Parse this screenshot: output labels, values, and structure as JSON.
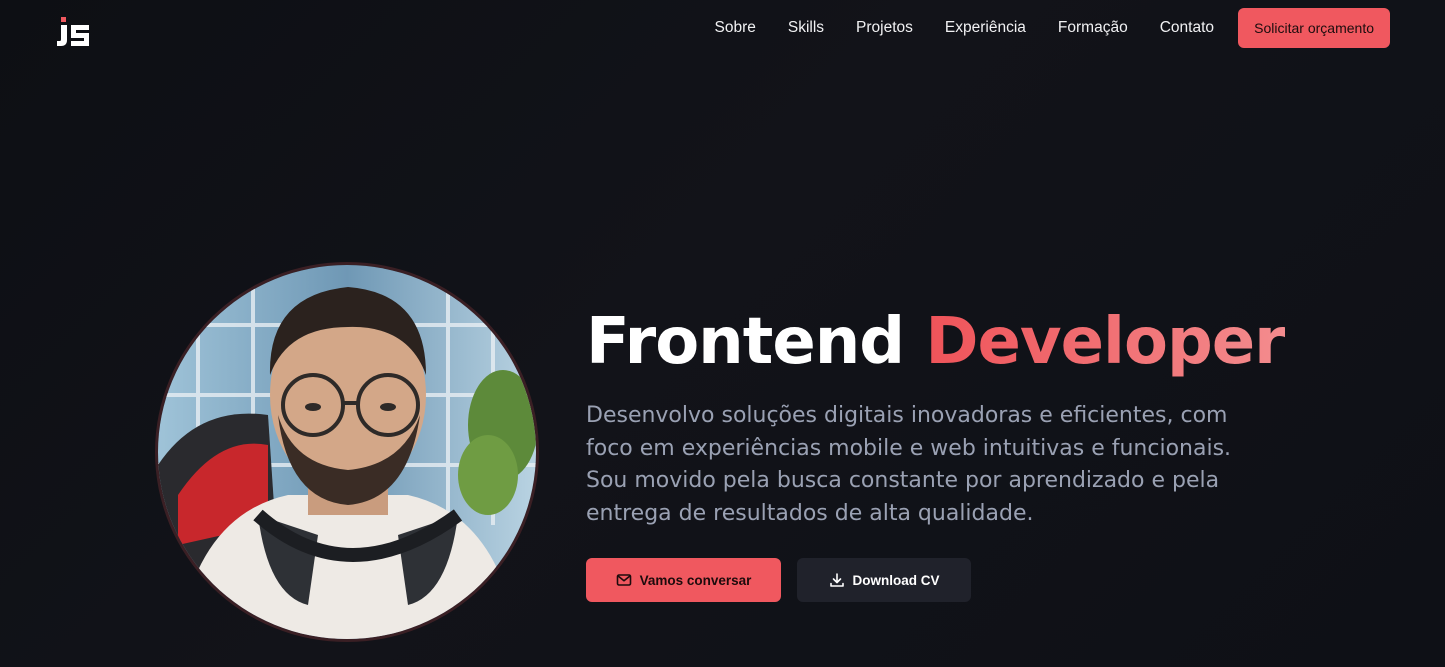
{
  "header": {
    "logo_text": "JS",
    "nav": [
      "Sobre",
      "Skills",
      "Projetos",
      "Experiência",
      "Formação",
      "Contato"
    ],
    "cta_label": "Solicitar orçamento"
  },
  "hero": {
    "title_part1": "Frontend",
    "title_part2": "Developer",
    "description": "Desenvolvo soluções digitais inovadoras e eficientes, com foco em experiências mobile e web intuitivas e funcionais. Sou movido pela busca constante por aprendizado e pela entrega de resultados de alta qualidade.",
    "primary_button": "Vamos conversar",
    "secondary_button": "Download CV",
    "primary_icon": "mail-icon",
    "secondary_icon": "download-icon"
  },
  "colors": {
    "accent": "#f0585f",
    "background": "#0e1016",
    "muted_text": "#9aa1b3",
    "button_dark": "#20222b"
  }
}
